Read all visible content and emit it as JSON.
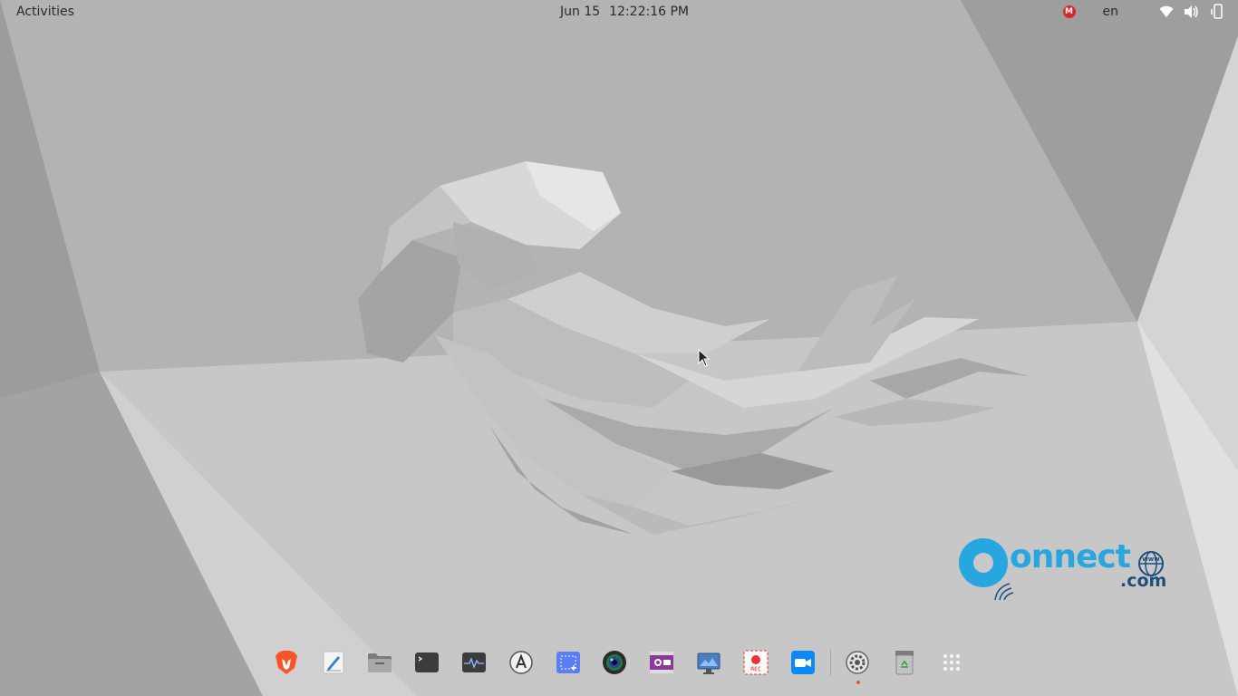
{
  "topbar": {
    "activities_label": "Activities",
    "date": "Jun 15",
    "time": "12:22:16 PM",
    "mega_badge": "M",
    "language": "en"
  },
  "watermark": {
    "brand": "onnect",
    "suffix": ".com",
    "globe_text": "www"
  },
  "dock": {
    "items": [
      {
        "name": "Brave Browser",
        "icon": "brave-lion-icon"
      },
      {
        "name": "Text Editor",
        "icon": "text-editor-icon"
      },
      {
        "name": "Files",
        "icon": "folder-icon"
      },
      {
        "name": "Terminal",
        "icon": "terminal-icon"
      },
      {
        "name": "System Monitor",
        "icon": "system-monitor-icon"
      },
      {
        "name": "Software Updater",
        "icon": "software-updater-icon"
      },
      {
        "name": "Screenshot",
        "icon": "screenshot-icon"
      },
      {
        "name": "Camera App",
        "icon": "camera-lens-icon"
      },
      {
        "name": "Video Recorder",
        "icon": "film-strip-icon"
      },
      {
        "name": "Presentation Tool",
        "icon": "desktop-slideshow-icon"
      },
      {
        "name": "Screen Recorder",
        "icon": "record-icon"
      },
      {
        "name": "Zoom",
        "icon": "zoom-camera-icon"
      },
      {
        "name": "Settings",
        "icon": "gear-icon"
      },
      {
        "name": "Trash",
        "icon": "trash-icon"
      },
      {
        "name": "Show Applications",
        "icon": "app-grid-icon"
      }
    ]
  },
  "colors": {
    "accent": "#e95420",
    "brand_blue": "#27a6df",
    "brand_dark": "#1d4f7e",
    "mega_red": "#d9272e"
  }
}
